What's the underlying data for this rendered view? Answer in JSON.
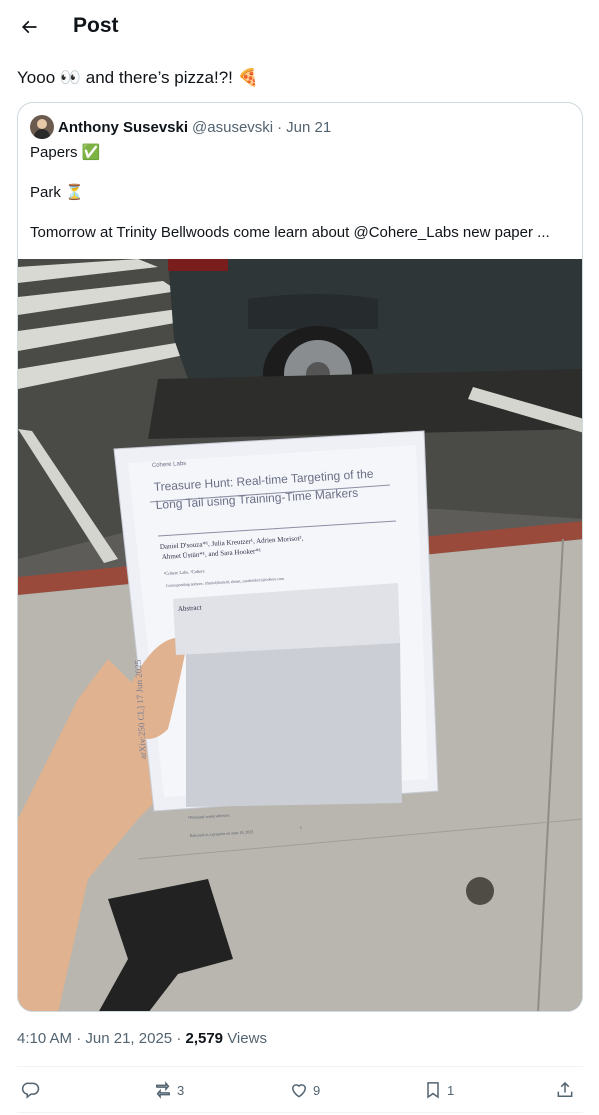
{
  "header": {
    "title": "Post"
  },
  "post": {
    "text": "Yooo 👀 and there’s pizza!?! 🍕"
  },
  "quote": {
    "author_name": "Anthony Susevski",
    "handle": "@asusevski",
    "separator": "·",
    "date": "Jun 21",
    "lines": [
      "Papers ✅",
      "Park ⏳",
      "Tomorrow at Trinity Bellwoods come learn about @Cohere_Labs new paper ..."
    ]
  },
  "paper": {
    "logo": "Cohere Labs",
    "title_line1": "Treasure Hunt: Real-time Targeting of the",
    "title_line2": "Long Tail using Training-Time Markers",
    "authors1": "Daniel D'souza*¹, Julia Kreutzer¹, Adrien Morisot²,",
    "authors2": "Ahmet Üstün*¹, and Sara Hooker*¹",
    "affil": "¹Cohere Labs, ²Cohere",
    "corresponding": "Corresponding authors: {daniel|danield, ahmet, sarahooker}@cohere.com",
    "abstract_label": "Abstract",
    "arxiv_side": "arXiv:250        CL]  17 Jun 2025",
    "footnote": "*Principal senior advisors.",
    "released": "Released as a preprint on June 18, 2025",
    "page_num": "1"
  },
  "meta": {
    "time": "4:10 AM",
    "date": "Jun 21, 2025",
    "separator": "·",
    "views_count": "2,579",
    "views_label": "Views"
  },
  "actions": {
    "reply_count": "",
    "repost_count": "3",
    "like_count": "9",
    "bookmark_count": "1"
  },
  "icons": [
    "back-arrow-icon",
    "reply-icon",
    "repost-icon",
    "like-icon",
    "bookmark-icon",
    "share-icon"
  ],
  "colors": {
    "text": "#0f1419",
    "secondary": "#536471",
    "border": "#cfd9de",
    "divider": "#eff3f4"
  }
}
